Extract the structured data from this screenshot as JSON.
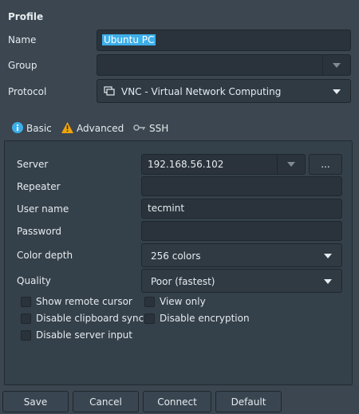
{
  "profile": {
    "section_title": "Profile",
    "name_label": "Name",
    "name_value": "Ubuntu PC",
    "group_label": "Group",
    "group_value": "",
    "protocol_label": "Protocol",
    "protocol_value": "VNC - Virtual Network Computing"
  },
  "tabs": [
    {
      "label": "Basic",
      "icon": "info-icon",
      "active": true
    },
    {
      "label": "Advanced",
      "icon": "warning-icon",
      "active": false
    },
    {
      "label": "SSH",
      "icon": "key-icon",
      "active": false
    }
  ],
  "basic": {
    "server_label": "Server",
    "server_value": "192.168.56.102",
    "browse_label": "...",
    "repeater_label": "Repeater",
    "repeater_value": "",
    "username_label": "User name",
    "username_value": "tecmint",
    "password_label": "Password",
    "password_value": "",
    "color_depth_label": "Color depth",
    "color_depth_value": "256 colors",
    "quality_label": "Quality",
    "quality_value": "Poor (fastest)",
    "checkboxes": {
      "show_remote_cursor": {
        "label": "Show remote cursor",
        "checked": false
      },
      "view_only": {
        "label": "View only",
        "checked": false
      },
      "disable_clipboard_sync": {
        "label": "Disable clipboard sync",
        "checked": false
      },
      "disable_encryption": {
        "label": "Disable encryption",
        "checked": false
      },
      "disable_server_input": {
        "label": "Disable server input",
        "checked": false
      }
    }
  },
  "buttons": {
    "save": "Save",
    "cancel": "Cancel",
    "connect": "Connect",
    "default": "Default"
  },
  "colors": {
    "background": "#3b4650",
    "field": "#2a333b",
    "accent": "#3daee9",
    "warning": "#f0a30a"
  }
}
